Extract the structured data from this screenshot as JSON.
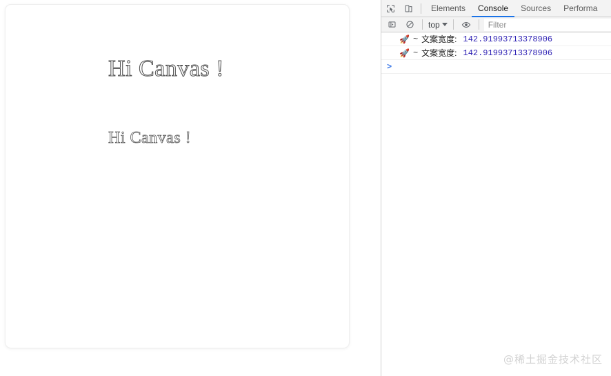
{
  "canvas": {
    "text_large": "Hi Canvas !",
    "text_small": "Hi Canvas !"
  },
  "devtools": {
    "icons": {
      "inspect": "inspect-element-icon",
      "device": "device-toolbar-icon",
      "sidebar": "console-sidebar-icon",
      "clear": "clear-console-icon",
      "eye": "eye-icon"
    },
    "tabs": [
      {
        "label": "Elements",
        "active": false
      },
      {
        "label": "Console",
        "active": true
      },
      {
        "label": "Sources",
        "active": false
      },
      {
        "label": "Performa",
        "active": false
      }
    ],
    "console_toolbar": {
      "context": "top",
      "filter_placeholder": "Filter",
      "filter_value": ""
    },
    "messages": [
      {
        "emoji": "🚀",
        "tilde": "~",
        "label": "文案宽度:",
        "value": "142.91993713378906"
      },
      {
        "emoji": "🚀",
        "tilde": "~",
        "label": "文案宽度:",
        "value": "142.91993713378906"
      }
    ],
    "prompt": ">"
  },
  "watermark": "@稀土掘金技术社区",
  "colors": {
    "accent_tab_underline": "#1a73e8",
    "console_value": "#2c1fb3",
    "prompt": "#3b78e7",
    "toolbar_bg": "#f3f3f3",
    "watermark": "#d2d2d2"
  }
}
